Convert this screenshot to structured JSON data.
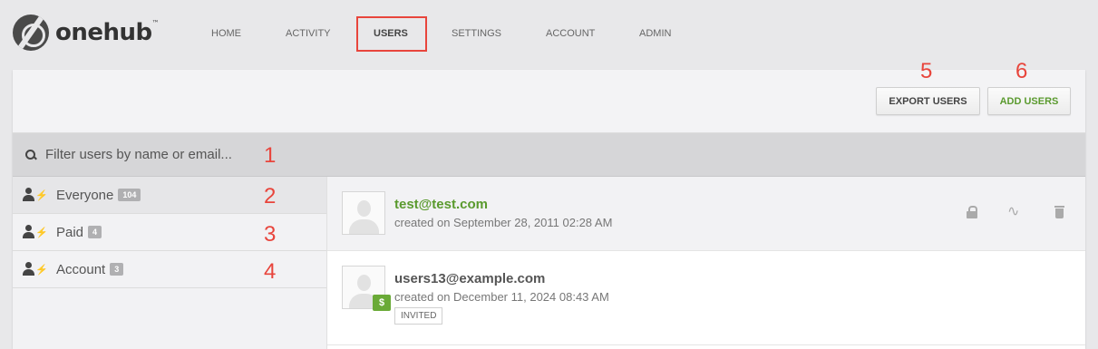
{
  "brand": {
    "name": "onehub",
    "mark": "™"
  },
  "nav": {
    "items": [
      {
        "label": "HOME"
      },
      {
        "label": "ACTIVITY"
      },
      {
        "label": "USERS"
      },
      {
        "label": "SETTINGS"
      },
      {
        "label": "ACCOUNT"
      },
      {
        "label": "ADMIN"
      }
    ],
    "active": "USERS"
  },
  "annotations": [
    "1",
    "2",
    "3",
    "4",
    "5",
    "6"
  ],
  "toolbar": {
    "export_label": "EXPORT USERS",
    "add_label": "ADD USERS"
  },
  "filter": {
    "placeholder": "Filter users by name or email...",
    "value": ""
  },
  "groups": [
    {
      "label": "Everyone",
      "count": "104"
    },
    {
      "label": "Paid",
      "count": "4"
    },
    {
      "label": "Account",
      "count": "3"
    }
  ],
  "users": [
    {
      "email": "test@test.com",
      "created": "created on September 28, 2011 02:28 AM"
    },
    {
      "email": "users13@example.com",
      "created": "created on December 11, 2024 08:43 AM",
      "paid_symbol": "$",
      "status": "INVITED"
    }
  ],
  "colors": {
    "accent_green": "#5a9a2e",
    "annotation_red": "#e8453c",
    "paid_badge": "#6aaa37"
  }
}
